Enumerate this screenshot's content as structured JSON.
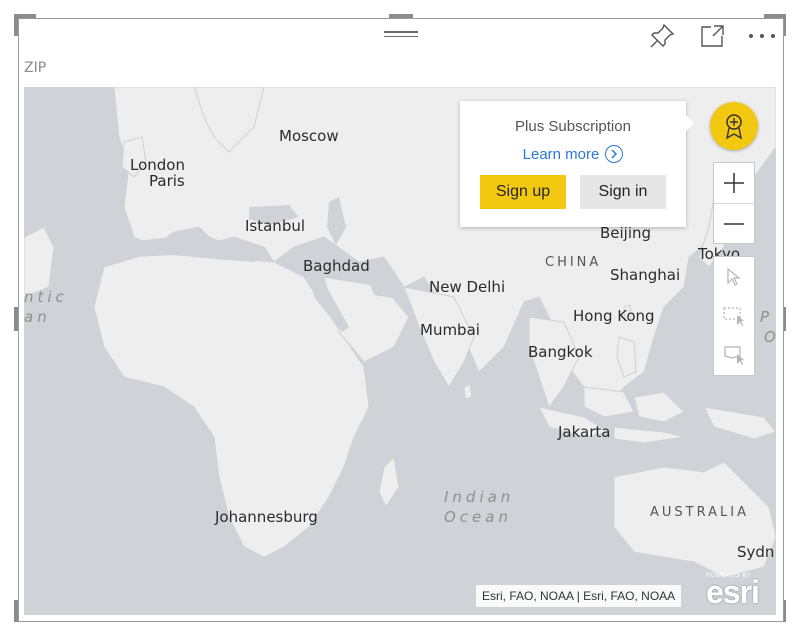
{
  "visual": {
    "title": "ZIP"
  },
  "header": {
    "icons": [
      "pin-icon",
      "focus-mode-icon",
      "more-options-icon"
    ]
  },
  "map": {
    "cities": [
      {
        "name": "Moscow",
        "key": "moscow"
      },
      {
        "name": "London",
        "key": "london"
      },
      {
        "name": "Paris",
        "key": "paris"
      },
      {
        "name": "Istanbul",
        "key": "istanbul"
      },
      {
        "name": "Baghdad",
        "key": "baghdad"
      },
      {
        "name": "New Delhi",
        "key": "new-delhi"
      },
      {
        "name": "Mumbai",
        "key": "mumbai"
      },
      {
        "name": "Beijing",
        "key": "beijing"
      },
      {
        "name": "Shanghai",
        "key": "shanghai"
      },
      {
        "name": "Tokyo",
        "key": "tokyo"
      },
      {
        "name": "Hong Kong",
        "key": "hong-kong"
      },
      {
        "name": "Bangkok",
        "key": "bangkok"
      },
      {
        "name": "Jakarta",
        "key": "jakarta"
      },
      {
        "name": "Johannesburg",
        "key": "johannesburg"
      },
      {
        "name": "Sydn",
        "key": "sydney"
      }
    ],
    "regions": {
      "china": "CHINA",
      "australia": "AUSTRALIA"
    },
    "oceans": {
      "indian_line1": "Indian",
      "indian_line2": "Ocean",
      "atlantic_line1": "ntic",
      "atlantic_line2": "an",
      "pacific_line1": "P",
      "pacific_line2": "O"
    },
    "attribution": "Esri, FAO, NOAA | Esri, FAO, NOAA",
    "logo_powered": "POWERED BY",
    "logo_text": "esri"
  },
  "popup": {
    "title": "Plus Subscription",
    "learn_more": "Learn more",
    "sign_up": "Sign up",
    "sign_in": "Sign in"
  },
  "controls": {
    "zoom_in": "+",
    "zoom_out": "—"
  },
  "colors": {
    "accent": "#f2c811",
    "link": "#2b79d8",
    "water": "#cfd3d8",
    "land": "#eeeeee"
  }
}
